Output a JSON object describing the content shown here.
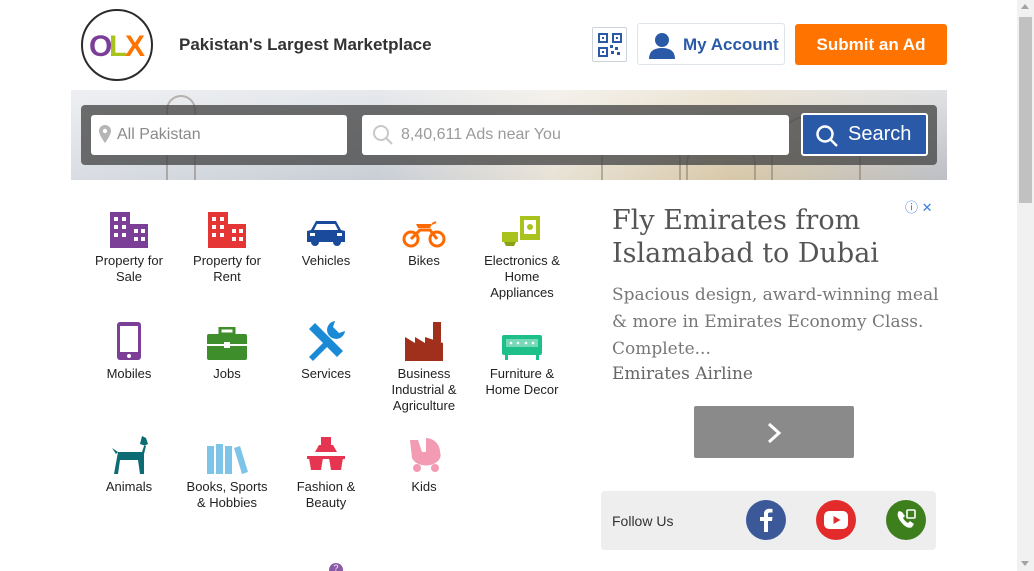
{
  "header": {
    "logo_text": "OLX",
    "tagline": "Pakistan's Largest Marketplace",
    "qr_icon": "qr-code-icon",
    "account_label": "My Account",
    "submit_label": "Submit an Ad",
    "accent_color": "#ff7300",
    "brand_blue": "#2a5aa7"
  },
  "search": {
    "location_placeholder": "All Pakistan",
    "keyword_placeholder": "8,40,611 Ads near You",
    "button_label": "Search"
  },
  "categories": [
    {
      "label_lines": [
        "Property for",
        "Sale"
      ],
      "icon": "building-icon",
      "color": "#7b3f98"
    },
    {
      "label_lines": [
        "Property for",
        "Rent"
      ],
      "icon": "building-icon",
      "color": "#e53535"
    },
    {
      "label_lines": [
        "Vehicles"
      ],
      "icon": "car-icon",
      "color": "#1a4a9c"
    },
    {
      "label_lines": [
        "Bikes"
      ],
      "icon": "motorbike-icon",
      "color": "#ff6a00"
    },
    {
      "label_lines": [
        "Electronics &",
        "Home",
        "Appliances"
      ],
      "icon": "appliance-icon",
      "color": "#a9c21c"
    },
    {
      "label_lines": [
        "Mobiles"
      ],
      "icon": "mobile-phone-icon",
      "color": "#7b3f98"
    },
    {
      "label_lines": [
        "Jobs"
      ],
      "icon": "briefcase-icon",
      "color": "#3e8e2b"
    },
    {
      "label_lines": [
        "Services"
      ],
      "icon": "tools-icon",
      "color": "#1a8ad6"
    },
    {
      "label_lines": [
        "Business",
        "Industrial &",
        "Agriculture"
      ],
      "icon": "factory-icon",
      "color": "#a0301c"
    },
    {
      "label_lines": [
        "Furniture &",
        "Home Decor"
      ],
      "icon": "sofa-icon",
      "color": "#1ec08a"
    },
    {
      "label_lines": [
        "Animals"
      ],
      "icon": "dog-icon",
      "color": "#0d6b74"
    },
    {
      "label_lines": [
        "Books, Sports",
        "& Hobbies"
      ],
      "icon": "books-icon",
      "color": "#7ec3e8"
    },
    {
      "label_lines": [
        "Fashion &",
        "Beauty"
      ],
      "icon": "fashion-icon",
      "color": "#e53550"
    },
    {
      "label_lines": [
        "Kids"
      ],
      "icon": "pram-icon",
      "color": "#f29bb2"
    }
  ],
  "ad": {
    "title": "Fly Emirates from Islamabad to Dubai",
    "description": "Spacious design, award-winning meal & more in Emirates Economy Class. Complete...",
    "brand": "Emirates Airline",
    "next_icon": "chevron-right-icon"
  },
  "follow": {
    "label": "Follow Us",
    "networks": [
      {
        "name": "facebook",
        "icon": "facebook-icon",
        "color": "#3b5998"
      },
      {
        "name": "youtube",
        "icon": "youtube-icon",
        "color": "#e32b2b"
      },
      {
        "name": "phone",
        "icon": "phone-icon",
        "color": "#3d7f1c"
      }
    ]
  }
}
